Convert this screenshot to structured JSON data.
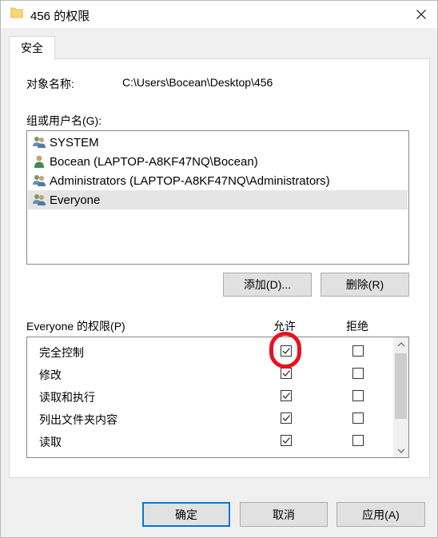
{
  "window": {
    "title": "456 的权限",
    "folder_icon": "folder-icon",
    "close_icon": "close-icon"
  },
  "tabs": [
    {
      "label": "安全",
      "active": true
    }
  ],
  "object": {
    "label": "对象名称:",
    "value": "C:\\Users\\Bocean\\Desktop\\456"
  },
  "groups": {
    "label": "组或用户名(G):",
    "items": [
      {
        "name": "SYSTEM",
        "icon": "user-group-icon",
        "selected": false
      },
      {
        "name": "Bocean (LAPTOP-A8KF47NQ\\Bocean)",
        "icon": "user-icon",
        "selected": false
      },
      {
        "name": "Administrators (LAPTOP-A8KF47NQ\\Administrators)",
        "icon": "user-group-icon",
        "selected": false
      },
      {
        "name": "Everyone",
        "icon": "user-group-icon",
        "selected": true
      }
    ],
    "add_label": "添加(D)...",
    "remove_label": "删除(R)"
  },
  "permissions": {
    "label": "Everyone 的权限(P)",
    "allow_header": "允许",
    "deny_header": "拒绝",
    "rows": [
      {
        "name": "完全控制",
        "allow": true,
        "deny": false
      },
      {
        "name": "修改",
        "allow": true,
        "deny": false
      },
      {
        "name": "读取和执行",
        "allow": true,
        "deny": false
      },
      {
        "name": "列出文件夹内容",
        "allow": true,
        "deny": false
      },
      {
        "name": "读取",
        "allow": true,
        "deny": false
      }
    ]
  },
  "footer": {
    "ok_label": "确定",
    "cancel_label": "取消",
    "apply_label": "应用(A)"
  },
  "colors": {
    "highlight_ring": "#e8121f",
    "default_button_border": "#0078d7",
    "folder": "#f8d775"
  }
}
